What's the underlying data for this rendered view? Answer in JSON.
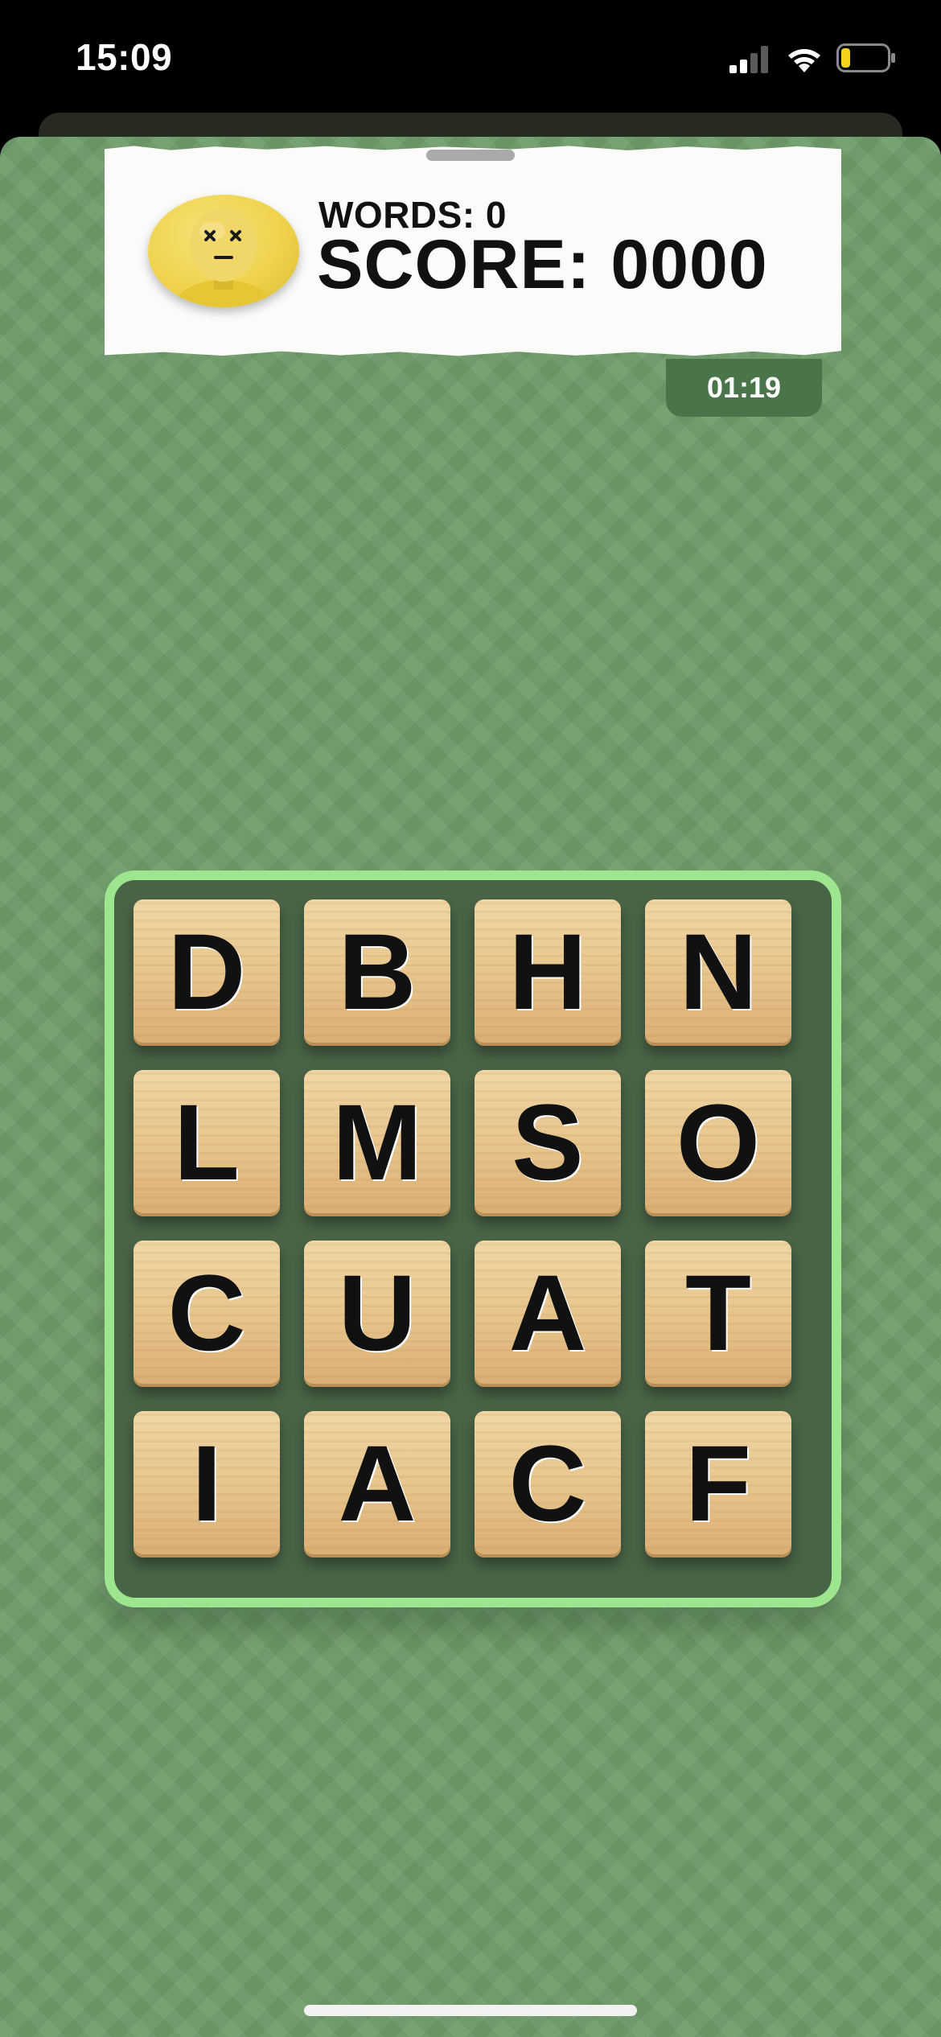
{
  "status_bar": {
    "time": "15:09",
    "icons": [
      "signal-icon",
      "wifi-icon",
      "battery-icon"
    ],
    "battery_level": 0.2
  },
  "score_panel": {
    "avatar_icon": "dizzy-face-avatar-icon",
    "words_text": "WORDS: 0",
    "score_text": "SCORE: 0000"
  },
  "timer": {
    "text": "01:19"
  },
  "board": {
    "tiles": [
      "D",
      "B",
      "H",
      "N",
      "L",
      "M",
      "S",
      "O",
      "C",
      "U",
      "A",
      "T",
      "I",
      "A",
      "C",
      "F"
    ]
  },
  "colors": {
    "background_green": "#6f9c6a",
    "board_border": "#9de58f",
    "board_fill": "#4a6447",
    "timer_bg": "#4a744a",
    "avatar_yellow": "#eed24a",
    "battery_fill": "#f2d21a"
  }
}
